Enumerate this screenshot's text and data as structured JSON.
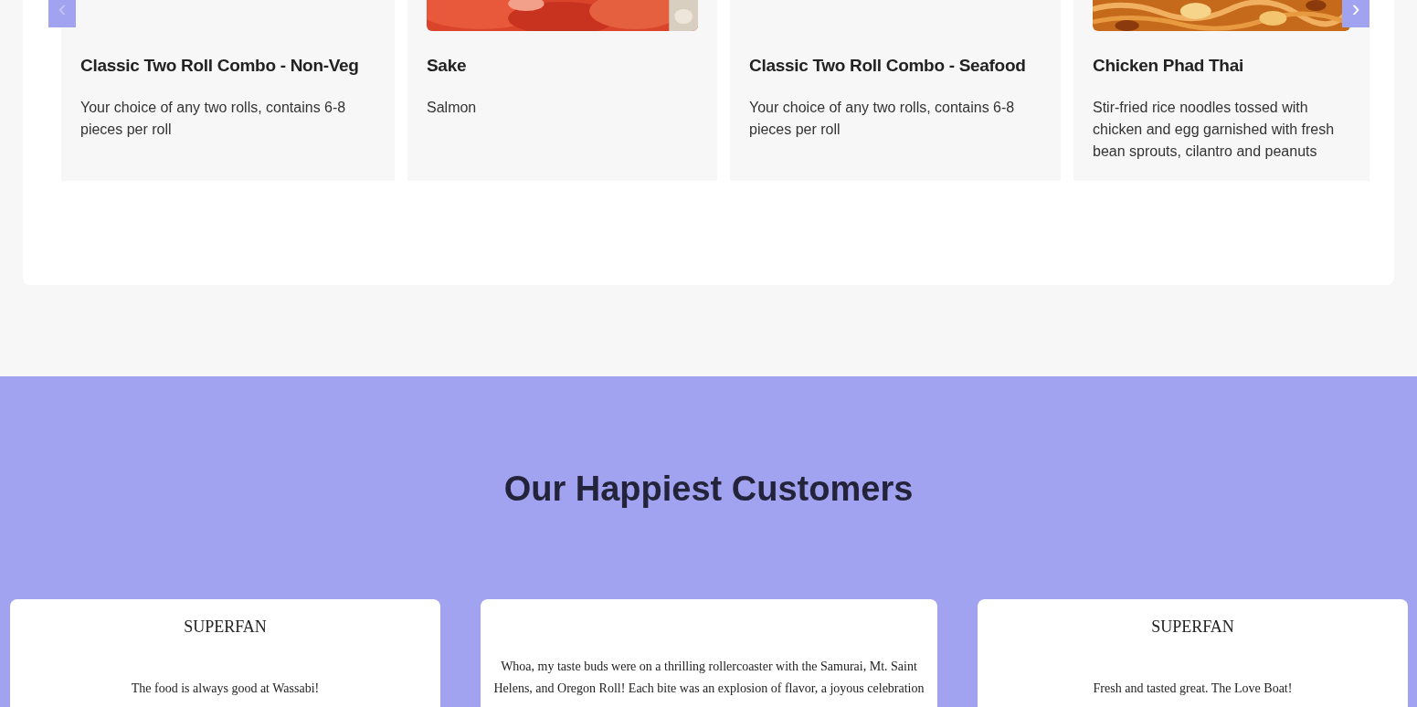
{
  "menu_carousel": {
    "prev_button": {
      "label": "‹",
      "disabled": true
    },
    "next_button": {
      "label": "›",
      "disabled": false
    },
    "items": [
      {
        "name": "Classic Two Roll Combo - Non-Veg",
        "description": "Your choice of any two rolls, contains 6-8 pieces per roll"
      },
      {
        "name": "Sake",
        "description": "Salmon"
      },
      {
        "name": "Classic Two Roll Combo - Seafood",
        "description": "Your choice of any two rolls, contains 6-8 pieces per roll"
      },
      {
        "name": "Chicken Phad Thai",
        "description": "Stir-fried rice noodles tossed with chicken and egg garnished with fresh bean sprouts, cilantro and peanuts"
      }
    ]
  },
  "testimonials": {
    "heading": "Our Happiest Customers",
    "items": [
      {
        "title": "SUPERFAN",
        "quote": "The food is always good at Wassabi!"
      },
      {
        "quote": "Whoa, my taste buds were on a thrilling rollercoaster with the Samurai, Mt. Saint Helens, and Oregon Roll! Each bite was an explosion of flavor, a joyous celebration"
      },
      {
        "title": "SUPERFAN",
        "quote": "Fresh and tasted great. The Love Boat!"
      }
    ]
  }
}
